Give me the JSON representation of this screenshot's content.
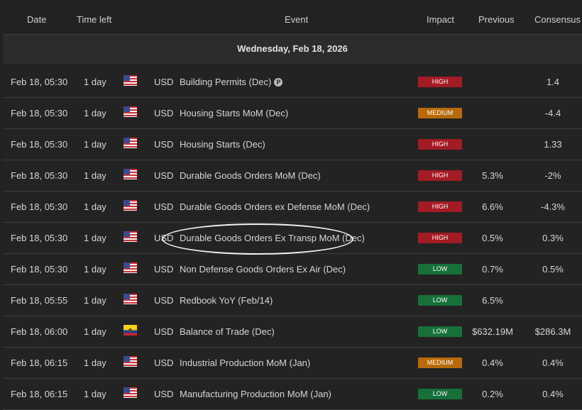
{
  "header": {
    "date": "Date",
    "time_left": "Time left",
    "event": "Event",
    "impact": "Impact",
    "previous": "Previous",
    "consensus": "Consensus"
  },
  "date_group": "Wednesday, Feb 18, 2026",
  "prelim_symbol": "P",
  "rows": [
    {
      "date": "Feb 18, 05:30",
      "time_left": "1 day",
      "flag": "us-flag-icon",
      "currency": "USD",
      "event": "Building Permits (Dec)",
      "impact": "HIGH",
      "previous": "",
      "consensus": "1.4"
    },
    {
      "date": "Feb 18, 05:30",
      "time_left": "1 day",
      "flag": "us-flag-icon",
      "currency": "USD",
      "event": "Housing Starts MoM (Dec)",
      "impact": "MEDIUM",
      "previous": "",
      "consensus": "-4.4"
    },
    {
      "date": "Feb 18, 05:30",
      "time_left": "1 day",
      "flag": "us-flag-icon",
      "currency": "USD",
      "event": "Housing Starts (Dec)",
      "impact": "HIGH",
      "previous": "",
      "consensus": "1.33"
    },
    {
      "date": "Feb 18, 05:30",
      "time_left": "1 day",
      "flag": "us-flag-icon",
      "currency": "USD",
      "event": "Durable Goods Orders MoM (Dec)",
      "impact": "HIGH",
      "previous": "5.3%",
      "consensus": "-2%"
    },
    {
      "date": "Feb 18, 05:30",
      "time_left": "1 day",
      "flag": "us-flag-icon",
      "currency": "USD",
      "event": "Durable Goods Orders ex Defense MoM (Dec)",
      "impact": "HIGH",
      "previous": "6.6%",
      "consensus": "-4.3%"
    },
    {
      "date": "Feb 18, 05:30",
      "time_left": "1 day",
      "flag": "us-flag-icon",
      "currency": "USD",
      "event": "Durable Goods Orders Ex Transp MoM (Dec)",
      "impact": "HIGH",
      "previous": "0.5%",
      "consensus": "0.3%"
    },
    {
      "date": "Feb 18, 05:30",
      "time_left": "1 day",
      "flag": "us-flag-icon",
      "currency": "USD",
      "event": "Non Defense Goods Orders Ex Air (Dec)",
      "impact": "LOW",
      "previous": "0.7%",
      "consensus": "0.5%"
    },
    {
      "date": "Feb 18, 05:55",
      "time_left": "1 day",
      "flag": "us-flag-icon",
      "currency": "USD",
      "event": "Redbook YoY (Feb/14)",
      "impact": "LOW",
      "previous": "6.5%",
      "consensus": ""
    },
    {
      "date": "Feb 18, 06:00",
      "time_left": "1 day",
      "flag": "ecuador-flag-icon",
      "currency": "USD",
      "event": "Balance of Trade (Dec)",
      "impact": "LOW",
      "previous": "$632.19M",
      "consensus": "$286.3M"
    },
    {
      "date": "Feb 18, 06:15",
      "time_left": "1 day",
      "flag": "us-flag-icon",
      "currency": "USD",
      "event": "Industrial Production MoM (Jan)",
      "impact": "MEDIUM",
      "previous": "0.4%",
      "consensus": "0.4%"
    },
    {
      "date": "Feb 18, 06:15",
      "time_left": "1 day",
      "flag": "us-flag-icon",
      "currency": "USD",
      "event": "Manufacturing Production MoM (Jan)",
      "impact": "LOW",
      "previous": "0.2%",
      "consensus": "0.4%"
    }
  ]
}
